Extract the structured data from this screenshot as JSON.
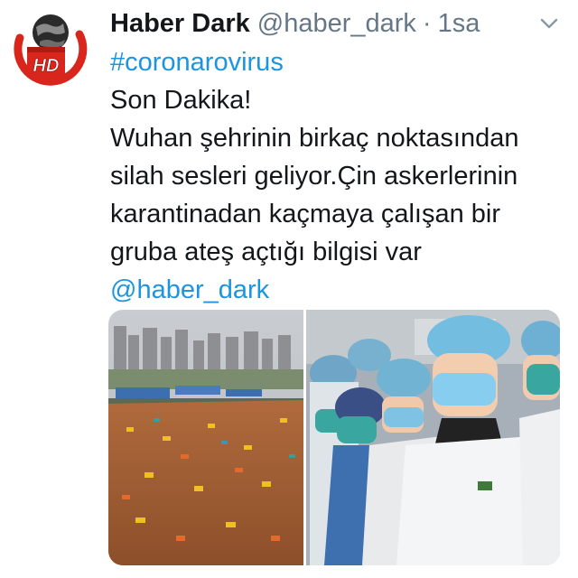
{
  "tweet": {
    "display_name": "Haber Dark",
    "handle": "@haber_dark",
    "separator": "·",
    "time": "1sa",
    "hashtag": "#coronarovirus",
    "lines": [
      "Son Dakika!",
      "Wuhan şehrinin birkaç noktasından",
      "silah sesleri geliyor.Çin askerlerinin",
      "karantinadan kaçmaya çalışan bir",
      "gruba ateş açtığı bilgisi var"
    ],
    "mention": "@haber_dark",
    "avatar_logo_text": "HD"
  },
  "media": [
    {
      "icon": "construction-site-photo"
    },
    {
      "icon": "medical-workers-photo"
    }
  ],
  "icons": {
    "menu": "chevron-down-icon"
  },
  "colors": {
    "link": "#1b95e0",
    "text": "#14171a",
    "secondary": "#657786",
    "avatar_red": "#d9261c"
  }
}
